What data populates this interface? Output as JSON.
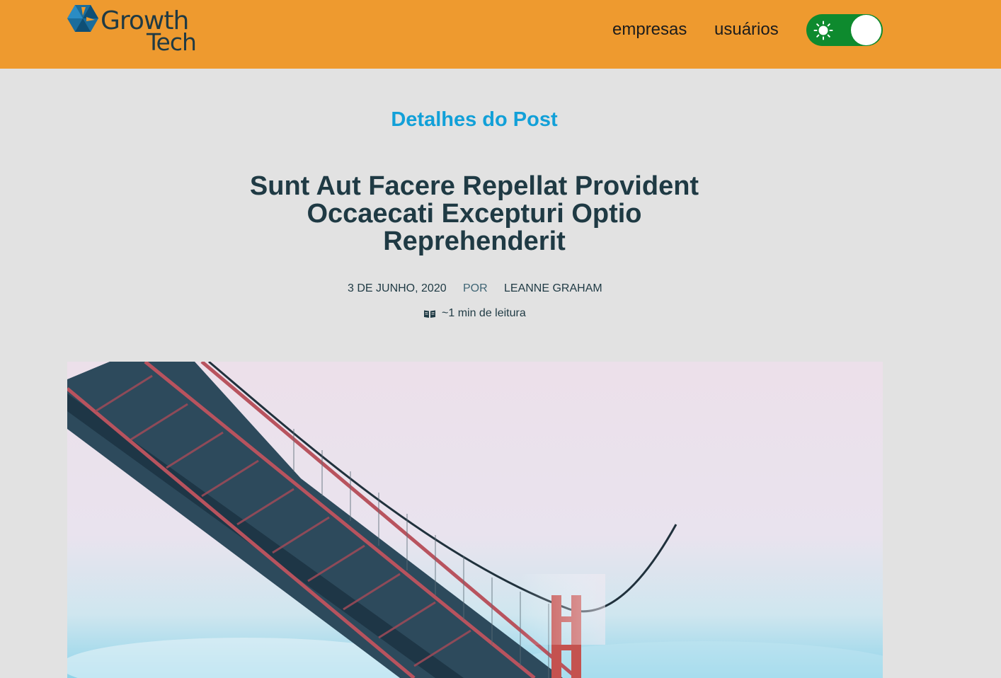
{
  "brand": {
    "name_line1": "Growth",
    "name_line2": "Tech"
  },
  "nav": {
    "items": [
      {
        "label": "empresas"
      },
      {
        "label": "usuários"
      }
    ]
  },
  "theme_toggle": {
    "icon": "sun-icon",
    "state": "light"
  },
  "page": {
    "section_title": "Detalhes do Post",
    "post_title": "Sunt Aut Facere Repellat Provident Occaecati Excepturi Optio Reprehenderit",
    "date": "3 DE JUNHO, 2020",
    "by_label": "POR",
    "author": "LEANNE GRAHAM",
    "reading_time": "~1 min de leitura",
    "reading_icon": "book-icon"
  },
  "colors": {
    "header_bg": "#ee9a2f",
    "accent_title": "#12a0d8",
    "toggle_bg": "#0e8a2e",
    "text_dark": "#1f3a44"
  }
}
